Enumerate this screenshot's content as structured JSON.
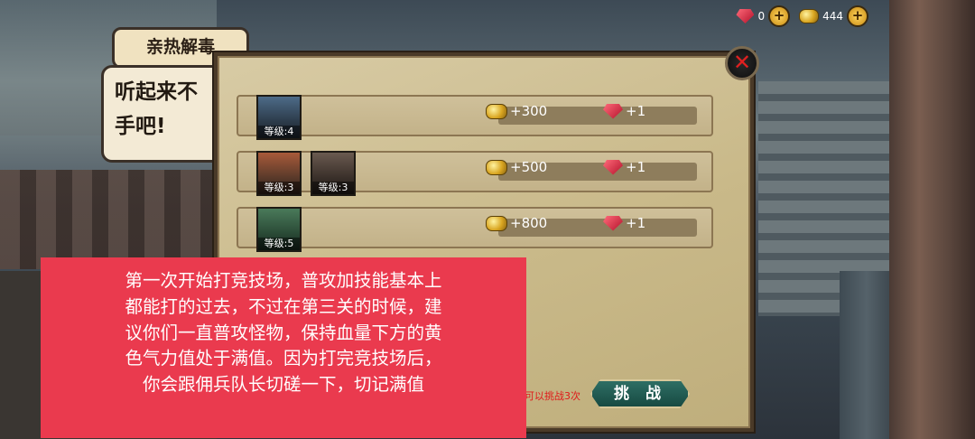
{
  "currency": {
    "ruby": "0",
    "gold": "444",
    "add": "+"
  },
  "dialog": {
    "tag": "亲热解毒",
    "line1": "听起来不",
    "line2": "手吧!"
  },
  "close_symbol": "✕",
  "stages": [
    {
      "portraits": [
        {
          "level": "等级:4",
          "icon": "knight-portrait"
        }
      ],
      "gold": "+300",
      "ruby": "+1"
    },
    {
      "portraits": [
        {
          "level": "等级:3",
          "icon": "valkyrie-portrait"
        },
        {
          "level": "等级:3",
          "icon": "rogue-portrait"
        }
      ],
      "gold": "+500",
      "ruby": "+1"
    },
    {
      "portraits": [
        {
          "level": "等级:5",
          "icon": "orc-portrait"
        }
      ],
      "gold": "+800",
      "ruby": "+1"
    }
  ],
  "challenge": {
    "hint": "可以挑战3次",
    "button": "挑 战"
  },
  "overlay_text": {
    "l1": "第一次开始打竞技场，普攻加技能基本上",
    "l2": "都能打的过去，不过在第三关的时候，建",
    "l3": "议你们一直普攻怪物，保持血量下方的黄",
    "l4": "色气力值处于满值。因为打完竞技场后，",
    "l5": "你会跟佣兵队长切磋一下，切记满值"
  },
  "colors": {
    "overlay": "#ea3a4e",
    "challenge_hint": "#e01818",
    "panel": "#c9b989"
  }
}
